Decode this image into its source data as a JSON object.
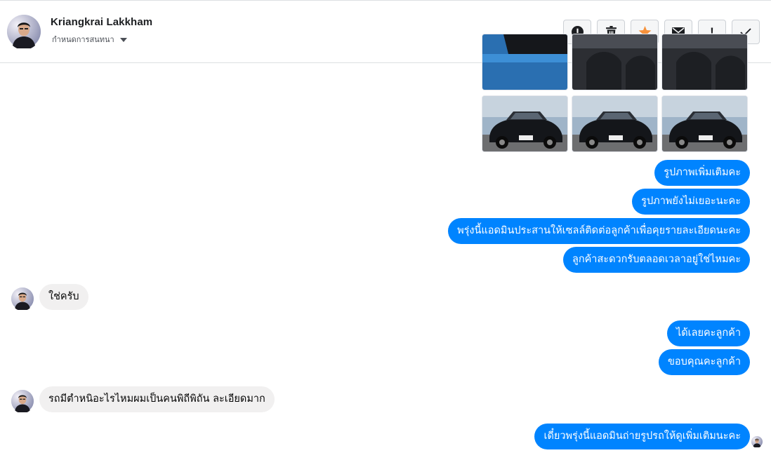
{
  "conversation": {
    "contact_name": "Kriangkrai Lakkham",
    "subtitle": "กำหนดการสนทนา",
    "subtitle_menu_icon": "chevron-down-icon"
  },
  "toolbar": {
    "buttons": [
      {
        "icon": "alert-circle-icon"
      },
      {
        "icon": "trash-icon"
      },
      {
        "icon": "star-icon",
        "color": "#f7923b"
      },
      {
        "icon": "envelope-icon"
      },
      {
        "icon": "exclamation-icon",
        "glyph": "!"
      },
      {
        "icon": "checkmark-icon"
      }
    ]
  },
  "photos": {
    "count": 6,
    "subject": "black sedan car"
  },
  "messages": [
    {
      "from": "page",
      "text": "รูปภาพเพิ่มเติมคะ"
    },
    {
      "from": "page",
      "text": "รูปภาพยังไม่เยอะนะคะ"
    },
    {
      "from": "page",
      "text": "พรุ่งนี้แอดมินประสานให้เซลล์ติดต่อลูกค้าเพื่อคุยรายละเอียดนะคะ"
    },
    {
      "from": "page",
      "text": "ลูกค้าสะดวกรับตลอดเวลาอยู่ใช่ไหมคะ"
    },
    {
      "from": "customer",
      "text": "ใช่ครับ"
    },
    {
      "from": "page",
      "text": "ได้เลยคะลูกค้า"
    },
    {
      "from": "page",
      "text": "ขอบคุณคะลูกค้า"
    },
    {
      "from": "customer",
      "text": "รถมีตำหนิอะไรไหมผมเป็นคนพิถีพิถัน ละเอียดมาก"
    },
    {
      "from": "page",
      "text": "เดี๋ยวพรุ่งนี้แอดมินถ่ายรูปรถให้ดูเพิ่มเติมนะคะ"
    }
  ],
  "colors": {
    "outgoing_bubble": "#0084ff",
    "incoming_bubble": "#f1f0f0",
    "star": "#f7923b"
  }
}
